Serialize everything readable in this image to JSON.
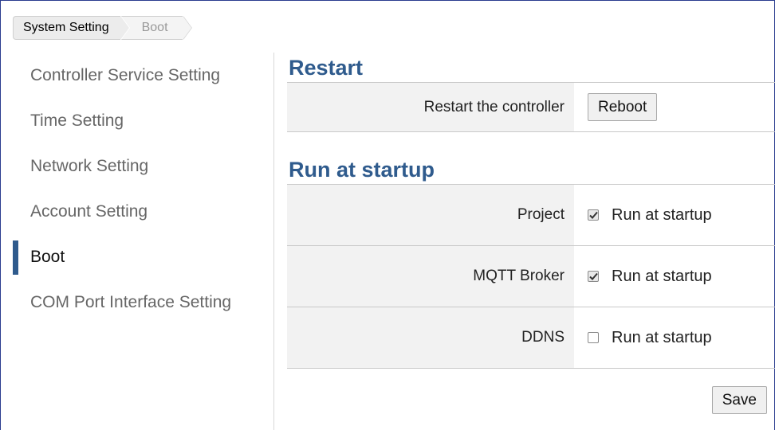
{
  "breadcrumb": {
    "root": "System Setting",
    "current": "Boot"
  },
  "sidebar": {
    "items": [
      {
        "label": "Controller Service Setting",
        "active": false
      },
      {
        "label": "Time Setting",
        "active": false
      },
      {
        "label": "Network Setting",
        "active": false
      },
      {
        "label": "Account Setting",
        "active": false
      },
      {
        "label": "Boot",
        "active": true
      },
      {
        "label": "COM Port Interface Setting",
        "active": false
      }
    ]
  },
  "restart": {
    "title": "Restart",
    "label": "Restart the controller",
    "button": "Reboot"
  },
  "startup": {
    "title": "Run at startup",
    "rows": [
      {
        "label": "Project",
        "option": "Run at startup",
        "checked": true
      },
      {
        "label": "MQTT Broker",
        "option": "Run at startup",
        "checked": true
      },
      {
        "label": "DDNS",
        "option": "Run at startup",
        "checked": false
      }
    ]
  },
  "actions": {
    "save": "Save"
  },
  "colors": {
    "accent": "#2f5b8d",
    "label_bg": "#f2f2f2",
    "frame": "#2a3c8f"
  }
}
